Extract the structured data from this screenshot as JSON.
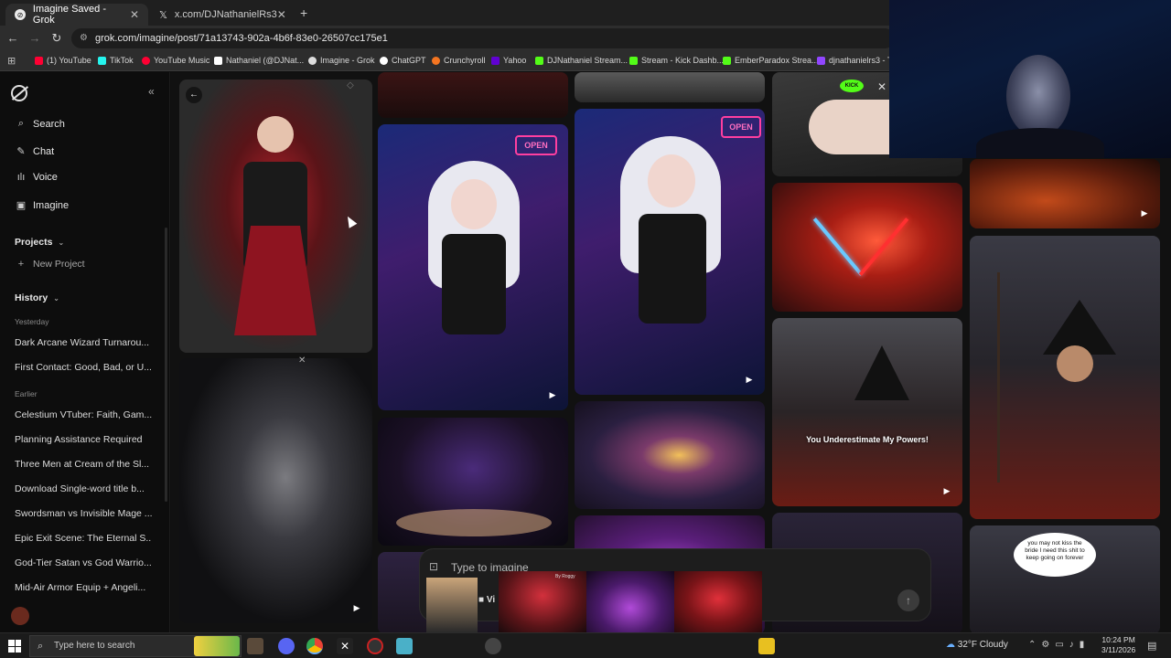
{
  "browser": {
    "tabs": [
      {
        "title": "Imagine Saved - Grok",
        "active": true
      },
      {
        "title": "x.com/DJNathanielRs3",
        "active": false
      }
    ],
    "new_tab_glyph": "+",
    "url": "grok.com/imagine/post/71a13743-902a-4b6f-83e0-26507cc175e1",
    "bookmarks": [
      {
        "label": "(1) YouTube",
        "color": "#ff0033"
      },
      {
        "label": "TikTok",
        "color": "#25f4ee"
      },
      {
        "label": "YouTube Music",
        "color": "#ff0033"
      },
      {
        "label": "Nathaniel (@DJNat...",
        "color": "#ffffff"
      },
      {
        "label": "Imagine - Grok",
        "color": "#dddddd"
      },
      {
        "label": "ChatGPT",
        "color": "#ffffff"
      },
      {
        "label": "Crunchyroll",
        "color": "#f47521"
      },
      {
        "label": "Yahoo",
        "color": "#6001d2"
      },
      {
        "label": "DJNathaniel Stream...",
        "color": "#53fc18"
      },
      {
        "label": "Stream - Kick Dashb...",
        "color": "#53fc18"
      },
      {
        "label": "EmberParadox Strea...",
        "color": "#53fc18"
      },
      {
        "label": "djnathanielrs3 - Tw",
        "color": "#9146ff"
      }
    ]
  },
  "sidebar": {
    "nav": [
      {
        "label": "Search",
        "icon": "search-icon"
      },
      {
        "label": "Chat",
        "icon": "chat-icon"
      },
      {
        "label": "Voice",
        "icon": "voice-icon"
      },
      {
        "label": "Imagine",
        "icon": "imagine-icon"
      }
    ],
    "projects_label": "Projects",
    "new_project_label": "New Project",
    "history_label": "History",
    "yesterday_label": "Yesterday",
    "earlier_label": "Earlier",
    "history_yesterday": [
      "Dark Arcane Wizard Turnarou...",
      "First Contact: Good, Bad, or U..."
    ],
    "history_earlier": [
      "Celestium VTuber: Faith, Gam...",
      "Planning Assistance Required",
      "Three Men at Cream of the Sl...",
      "Download Single-word title b...",
      "Swordsman vs Invisible Mage ...",
      "Epic Exit Scene: The Eternal S...",
      "God-Tier Satan vs God Warrio...",
      "Mid-Air Armor Equip + Angeli..."
    ]
  },
  "gallery": {
    "caption_wizard": "You Underestimate My Powers!",
    "caption_speech": "you may not kiss the bride I need this shit to keep going on forever",
    "overlay_open_sign": "OPEN",
    "overlay_kick": "KICK",
    "overlay_by": "By Roggy",
    "play_glyph": "▶"
  },
  "prompt": {
    "placeholder": "Type to imagine",
    "video_label": "Vi"
  },
  "taskbar": {
    "search_placeholder": "Type here to search",
    "weather": "32°F  Cloudy",
    "time": "10:24 PM",
    "date": "3/11/2026"
  },
  "colors": {
    "sidebar_bg": "#0d0d0d",
    "gallery_bg": "#111111",
    "accent_red": "#c8182a"
  }
}
